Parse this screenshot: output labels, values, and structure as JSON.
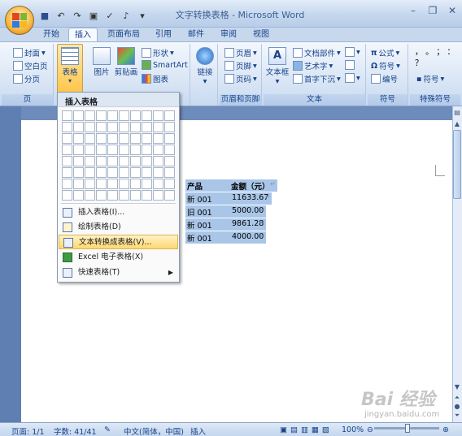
{
  "window": {
    "title": "文字转换表格 - Microsoft Word",
    "controls": [
      "minimize-icon",
      "restore-icon",
      "close-icon"
    ]
  },
  "tabs": [
    "开始",
    "插入",
    "页面布局",
    "引用",
    "邮件",
    "审阅",
    "视图"
  ],
  "active_tab": "插入",
  "ribbon": {
    "pages": {
      "cover": "封面",
      "blank": "空白页",
      "break": "分页",
      "label": "页"
    },
    "table": {
      "label": "表格"
    },
    "illustrations": {
      "picture": "图片",
      "clipart": "剪贴画",
      "shapes": "形状",
      "smartart": "SmartArt",
      "chart": "图表"
    },
    "links": {
      "label": "链接"
    },
    "header_footer": {
      "header": "页眉",
      "footer": "页脚",
      "page_number": "页码",
      "label": "页眉和页脚"
    },
    "text": {
      "textbox": "文本框",
      "quickparts": "文档部件",
      "wordart": "艺术字",
      "dropcap": "首字下沉",
      "label": "文本"
    },
    "symbols": {
      "equation": "公式",
      "symbol": "符号",
      "numbering": "编号",
      "label": "符号"
    },
    "special": {
      "chars": "，  。  ；  ：  ？",
      "symbol": "符号",
      "label": "特殊符号"
    }
  },
  "dropdown": {
    "title": "插入表格",
    "items": [
      {
        "label": "插入表格(I)...",
        "icon": "insert-table-icon"
      },
      {
        "label": "绘制表格(D)",
        "icon": "draw-table-icon"
      },
      {
        "label": "文本转换成表格(V)...",
        "icon": "convert-text-icon",
        "highlighted": true
      },
      {
        "label": "Excel 电子表格(X)",
        "icon": "excel-icon"
      },
      {
        "label": "快速表格(T)",
        "icon": "quick-table-icon",
        "submenu": true
      }
    ]
  },
  "document": {
    "header": {
      "col1": "产品",
      "col2": "金额（元）"
    },
    "rows": [
      {
        "col1": "新 001",
        "col2": "11633.67"
      },
      {
        "col1": "旧 001",
        "col2": "5000.00"
      },
      {
        "col1": "新 001",
        "col2": "9861.28"
      },
      {
        "col1": "新 001",
        "col2": "4000.00"
      }
    ],
    "paragraph_mark": "↵"
  },
  "statusbar": {
    "page": "页面: 1/1",
    "words": "字数: 41/41",
    "language": "中文(简体，中国)",
    "mode": "插入",
    "zoom": "100%"
  },
  "watermark": {
    "text": "Bai 经验",
    "url": "jingyan.baidu.com"
  }
}
